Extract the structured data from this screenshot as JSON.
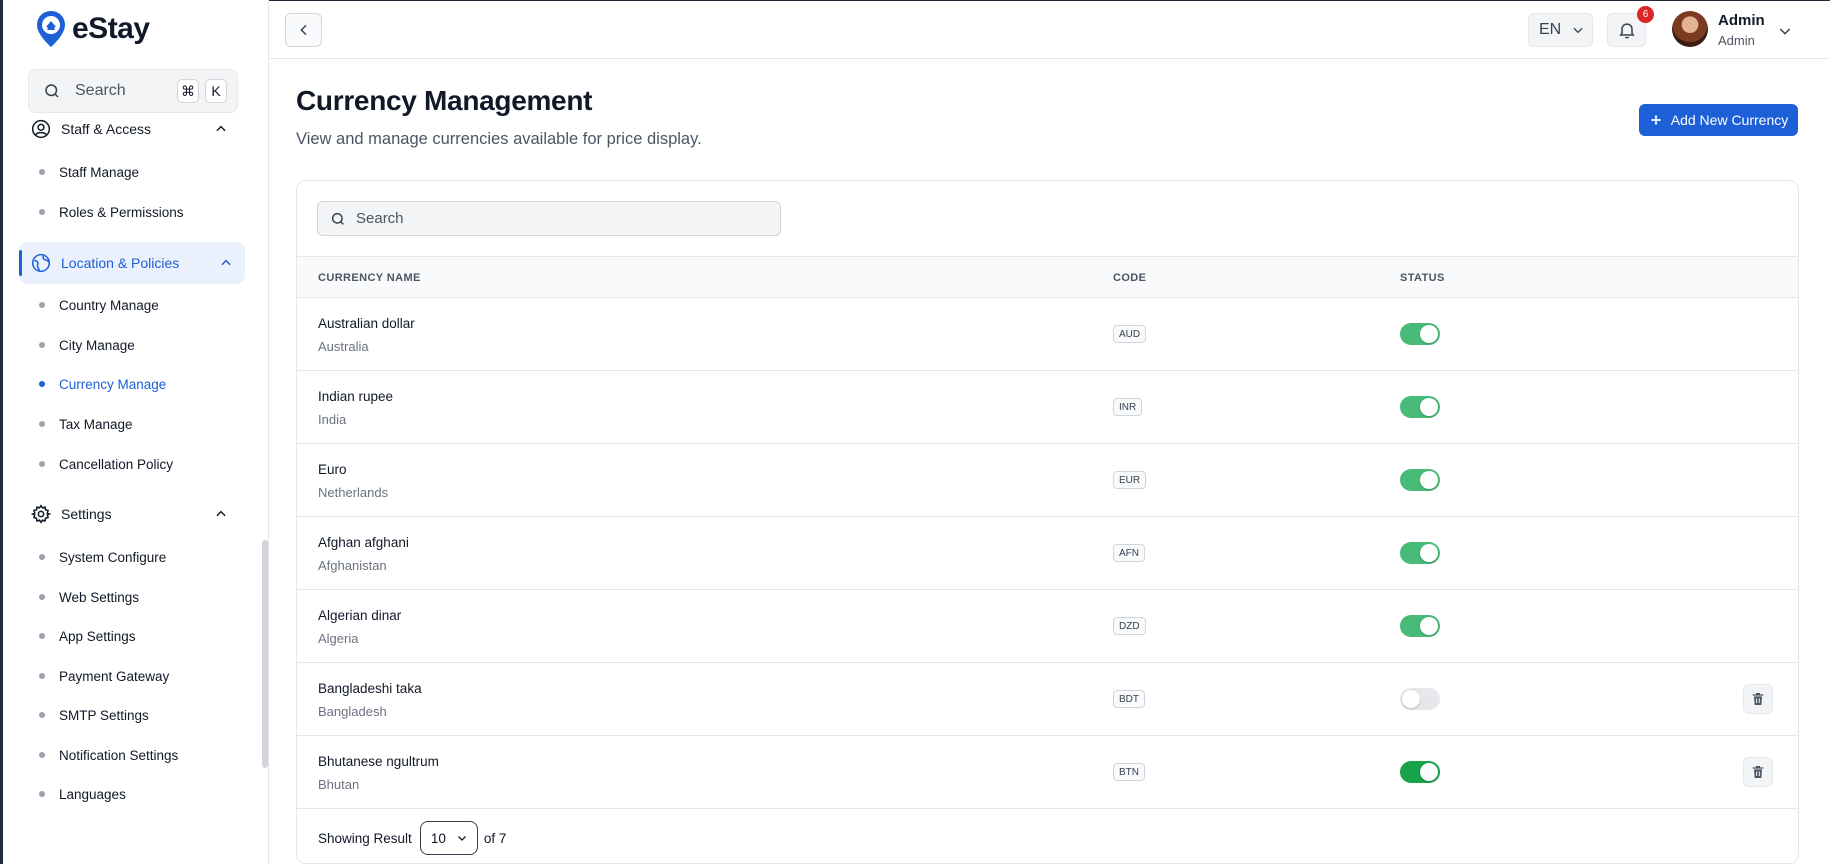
{
  "app": {
    "brand": "eStay"
  },
  "sidebar": {
    "search": {
      "label": "Search",
      "shortcut_cmd": "⌘",
      "shortcut_key": "K"
    },
    "groups": [
      {
        "label": "Staff & Access",
        "items": [
          "Staff Manage",
          "Roles & Permissions"
        ]
      },
      {
        "label": "Location & Policies",
        "items": [
          "Country Manage",
          "City Manage",
          "Currency Manage",
          "Tax Manage",
          "Cancellation Policy"
        ]
      },
      {
        "label": "Settings",
        "items": [
          "System Configure",
          "Web Settings",
          "App Settings",
          "Payment Gateway",
          "SMTP Settings",
          "Notification Settings",
          "Languages"
        ]
      }
    ],
    "active_item": "Currency Manage"
  },
  "topbar": {
    "language": "EN",
    "notifications_count": "6",
    "user": {
      "name": "Admin",
      "role": "Admin"
    }
  },
  "page": {
    "title": "Currency Management",
    "subtitle": "View and manage currencies available for price display.",
    "add_button": "Add New Currency"
  },
  "table": {
    "search_placeholder": "Search",
    "columns": {
      "name": "CURRENCY NAME",
      "code": "CODE",
      "status": "STATUS"
    },
    "rows": [
      {
        "name": "Australian dollar",
        "country": "Australia",
        "code": "AUD",
        "status": "on"
      },
      {
        "name": "Indian rupee",
        "country": "India",
        "code": "INR",
        "status": "on"
      },
      {
        "name": "Euro",
        "country": "Netherlands",
        "code": "EUR",
        "status": "on"
      },
      {
        "name": "Afghan afghani",
        "country": "Afghanistan",
        "code": "AFN",
        "status": "on"
      },
      {
        "name": "Algerian dinar",
        "country": "Algeria",
        "code": "DZD",
        "status": "on"
      },
      {
        "name": "Bangladeshi taka",
        "country": "Bangladesh",
        "code": "BDT",
        "status": "off"
      },
      {
        "name": "Bhutanese ngultrum",
        "country": "Bhutan",
        "code": "BTN",
        "status": "on"
      }
    ],
    "footer": {
      "showing_label": "Showing Result",
      "page_size": "10",
      "total_label": "of 7"
    }
  },
  "colors": {
    "accent": "#1d5fd6",
    "toggle_on": "#48bb78",
    "badge": "#dc2626"
  }
}
